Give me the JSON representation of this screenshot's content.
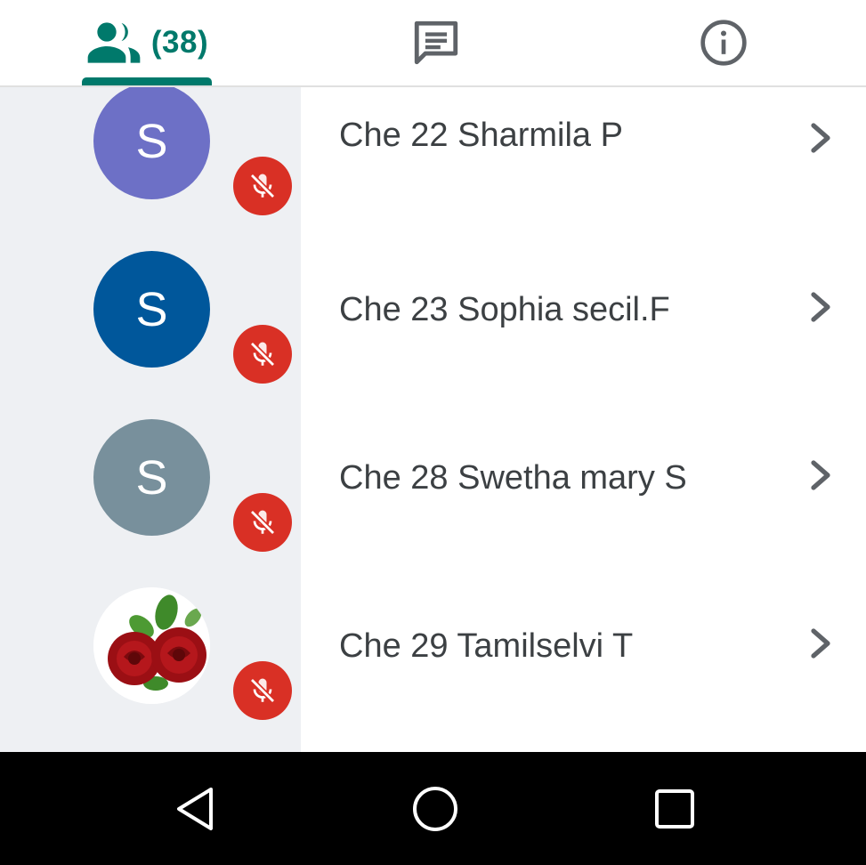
{
  "tabs": {
    "people": {
      "icon": "people-icon",
      "count": "(38)"
    },
    "chat": {
      "icon": "chat-icon"
    },
    "info": {
      "icon": "info-icon"
    },
    "accent": "#00796b"
  },
  "participants": [
    {
      "initial": "S",
      "name": "Che 22 Sharmila P",
      "avatar_color": "#6d70c6",
      "avatar_type": "initial",
      "muted": true
    },
    {
      "initial": "S",
      "name": "Che 23 Sophia secil.F",
      "avatar_color": "#00579b",
      "avatar_type": "initial",
      "muted": true
    },
    {
      "initial": "S",
      "name": "Che 28 Swetha mary S",
      "avatar_color": "#78909c",
      "avatar_type": "initial",
      "muted": true
    },
    {
      "initial": "",
      "name": "Che 29 Tamilselvi T",
      "avatar_color": "#ffffff",
      "avatar_type": "rose-photo",
      "muted": true
    }
  ],
  "mute_color": "#d93025",
  "navbar": {
    "back": "back-icon",
    "home": "home-icon",
    "recents": "recents-icon"
  }
}
